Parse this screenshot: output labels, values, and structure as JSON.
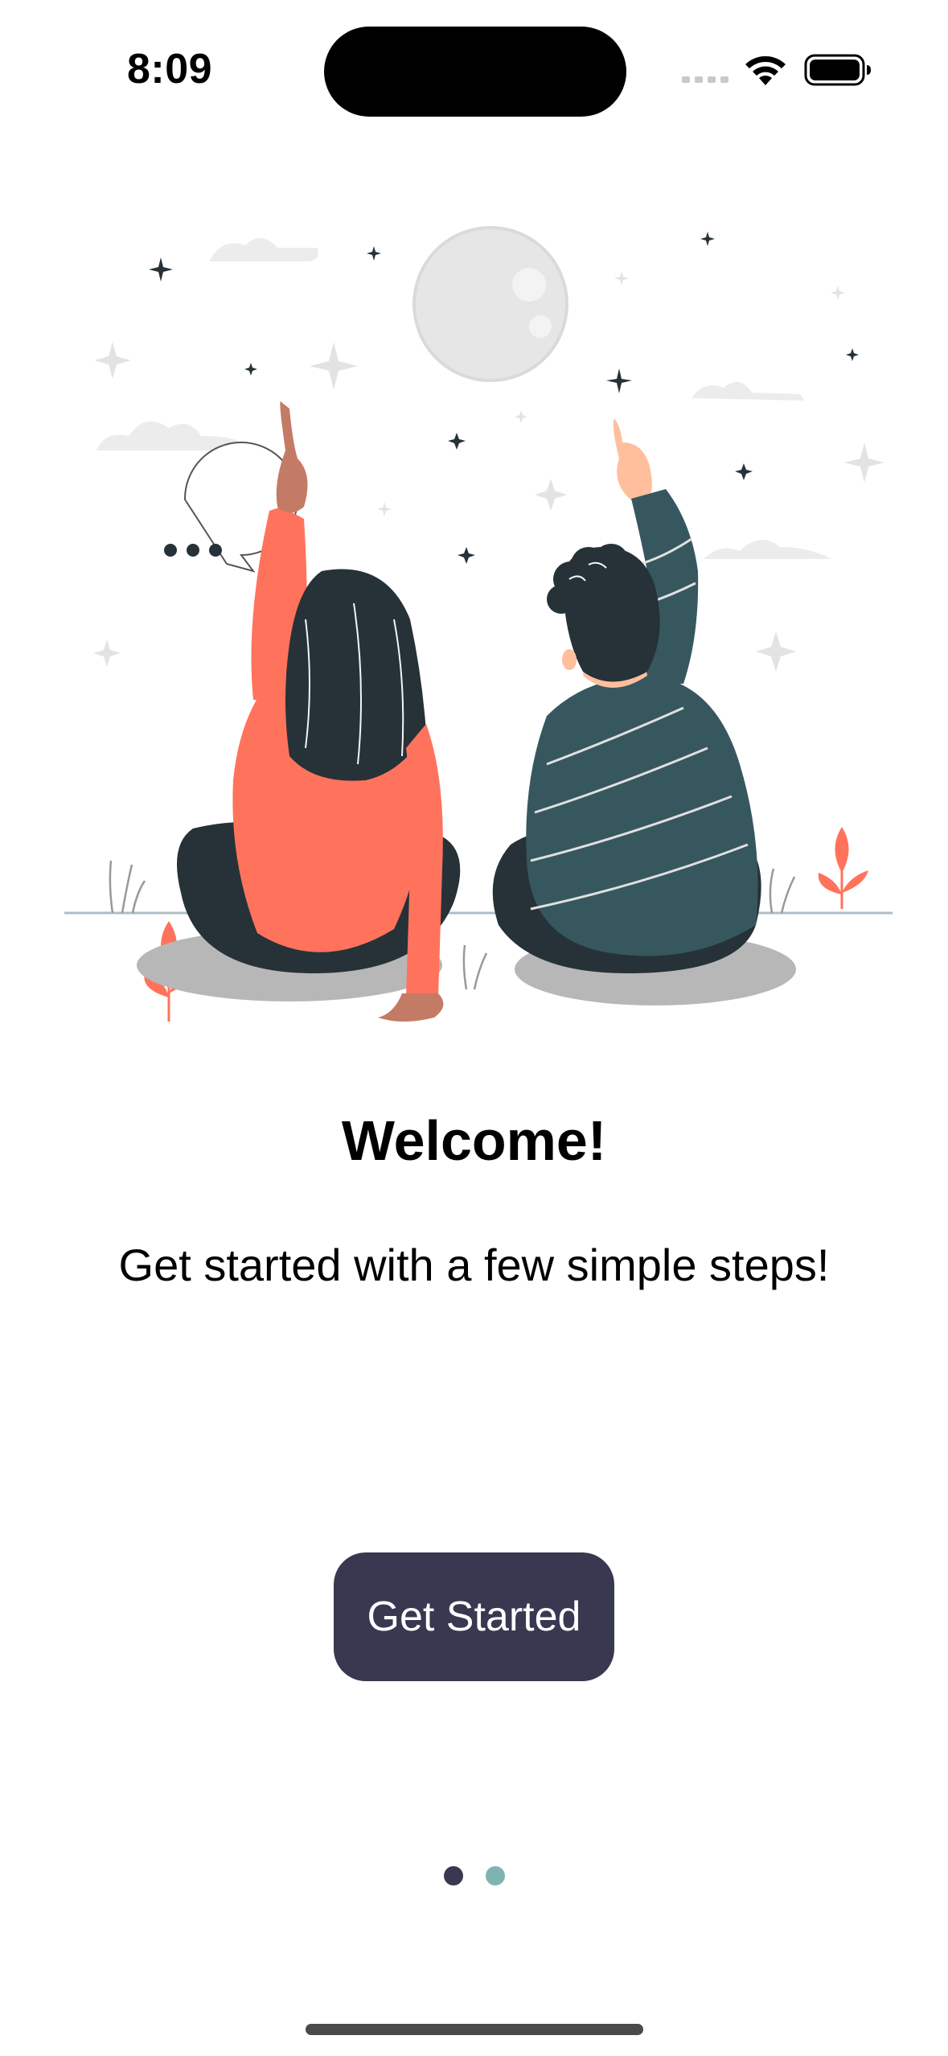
{
  "status_bar": {
    "time": "8:09"
  },
  "onboarding": {
    "title": "Welcome!",
    "subtitle": "Get started with a few simple steps!",
    "cta_label": "Get Started"
  },
  "pagination": {
    "total_pages": 2,
    "current_page": 1,
    "active_color": "#383850",
    "inactive_color": "#7fb3b0"
  },
  "colors": {
    "button_bg": "#383850",
    "button_text": "#ffffff",
    "accent_coral": "#ff735c",
    "dark_teal": "#263238",
    "sweater_teal": "#37575f"
  },
  "icons": {
    "signal": "cellular-signal-icon",
    "wifi": "wifi-icon",
    "battery": "battery-icon",
    "chat": "chat-bubble-icon"
  }
}
